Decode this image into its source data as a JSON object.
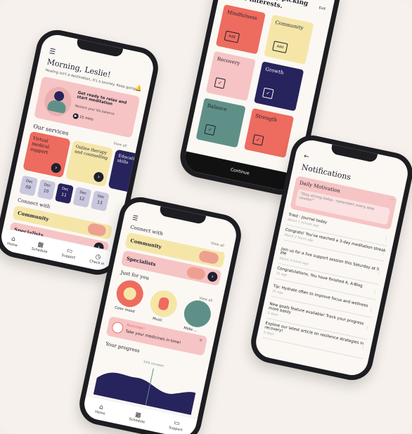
{
  "colors": {
    "bg": "#f6f1ec",
    "coral": "#ee6b5f",
    "pink": "#f6c4c4",
    "cream": "#f5e6a8",
    "navy": "#27235c",
    "teal": "#5f9088",
    "dark": "#1f1f2e"
  },
  "home": {
    "greeting": "Morning, Leslie!",
    "subtitle": "Healing isn't a destination, it's a journey. Keep going.",
    "meditation_title": "Get ready to relax and start meditation",
    "meditation_sub": "Restore your life balance",
    "meditation_time": "15 mins",
    "services_heading": "Our services",
    "services": [
      {
        "label": "Virtual medical support"
      },
      {
        "label": "Online therapy and counselling"
      },
      {
        "label": "Educational skills"
      }
    ],
    "view_all": "View all",
    "dates": [
      {
        "day": "Dec",
        "num": "09"
      },
      {
        "day": "Dec",
        "num": "10"
      },
      {
        "day": "Dec",
        "num": "11"
      },
      {
        "day": "Dec",
        "num": "12"
      },
      {
        "day": "Dec",
        "num": "13"
      }
    ],
    "connect_heading": "Connect with",
    "connect_items": [
      "Community",
      "Specialists"
    ],
    "tabs": [
      "Home",
      "Schedule",
      "Support",
      "Check in"
    ]
  },
  "interests": {
    "title": "Get started by picking some interests.",
    "exit": "Exit",
    "items": [
      {
        "label": "Mindfulness",
        "action": "Add"
      },
      {
        "label": "Community",
        "action": "Add"
      },
      {
        "label": "Recovery",
        "action": "✓"
      },
      {
        "label": "Growth",
        "action": "✓"
      },
      {
        "label": "Balance",
        "action": "✓"
      },
      {
        "label": "Strength",
        "action": "✓"
      }
    ],
    "continue": "Continue"
  },
  "explore": {
    "connect_heading": "Connect with",
    "connect_items": [
      "Community",
      "Specialists"
    ],
    "view_all": "View all",
    "just_for_you": "Just for you",
    "categories": [
      "Color mood",
      "Music",
      "Make ..."
    ],
    "reminder_title": "Reminder!",
    "reminder_text": "Take your medicines in time!",
    "progress_heading": "Your progress",
    "progress_badge": "43% increase",
    "tabs": [
      "Home",
      "Schedule",
      "Support"
    ]
  },
  "notifications": {
    "title": "Notifications",
    "daily_title": "Daily Motivation",
    "daily_quote": "\"Stay strong today - remember, every step counts!\"",
    "items": [
      {
        "text": "Tried : Journal today",
        "time": "About 1 minute ago"
      },
      {
        "text": "Congrats! You've reached a 3-day meditation streak",
        "time": "About 2 hours ago"
      },
      {
        "text": "Join us for a live support session this Saturday at 5 PM",
        "time": "About 3 hours ago"
      },
      {
        "text": "Congratulations, You have finished A, A-Blog",
        "time": "1h ago"
      },
      {
        "text": "Tip: Hydrate often to improve focus and wellness",
        "time": "2h ago"
      },
      {
        "text": "New goals feature available! Track your progress more easily",
        "time": "5 days"
      },
      {
        "text": "Explore our latest article on resilience strategies in recovery!",
        "time": "5 days"
      }
    ]
  }
}
